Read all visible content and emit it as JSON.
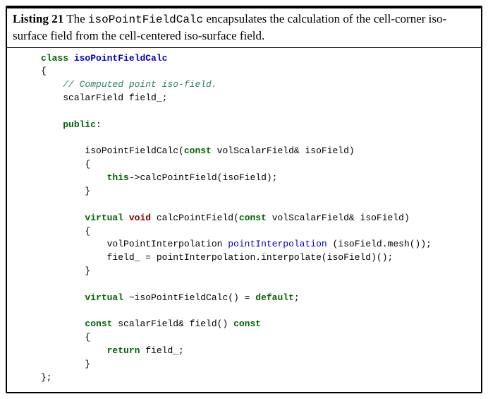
{
  "listing": {
    "number_label": "Listing 21",
    "caption_prefix": " The ",
    "caption_code": "isoPointFieldCalc",
    "caption_suffix": " encapsulates the calculation of the cell-corner iso-surface field from the cell-centered iso-surface field."
  },
  "code": {
    "kw_class": "class",
    "cls_name": "isoPointFieldCalc",
    "open_brace": "{",
    "comment_field": "// Computed point iso-field.",
    "decl_field": "scalarField field_;",
    "kw_public": "public",
    "colon": ":",
    "ctor_name": "isoPointFieldCalc(",
    "kw_const1": "const",
    "ctor_params": " volScalarField& isoField)",
    "open_brace2": "{",
    "kw_this": "this",
    "ctor_body": "->calcPointField(isoField);",
    "close_brace2": "}",
    "kw_virtual1": "virtual",
    "kw_void": "void",
    "calc_sig1": " calcPointField(",
    "kw_const2": "const",
    "calc_sig2": " volScalarField& isoField)",
    "open_brace3": "{",
    "calc_line1a": "volPointInterpolation ",
    "calc_line1b": "pointInterpolation",
    "calc_line1c": " (isoField.mesh());",
    "calc_line2": "field_ = pointInterpolation.interpolate(isoField)();",
    "close_brace3": "}",
    "kw_virtual2": "virtual",
    "dtor": " ~isoPointFieldCalc() = ",
    "kw_default": "default",
    "semi": ";",
    "kw_const3": "const",
    "getter_sig1": " scalarField& field() ",
    "kw_const4": "const",
    "open_brace4": "{",
    "kw_return": "return",
    "getter_body": " field_;",
    "close_brace4": "}",
    "close_brace1": "};"
  }
}
